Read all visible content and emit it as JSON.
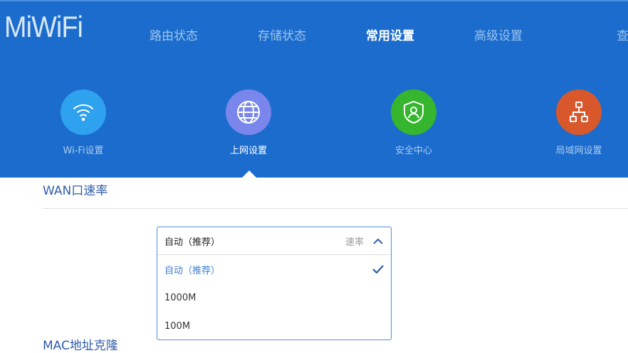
{
  "header": {
    "logo": "MiWiFi",
    "nav": [
      {
        "label": "路由状态",
        "active": false
      },
      {
        "label": "存储状态",
        "active": false
      },
      {
        "label": "常用设置",
        "active": true
      },
      {
        "label": "高级设置",
        "active": false
      },
      {
        "label": "查",
        "active": false
      }
    ]
  },
  "tiles": [
    {
      "label": "Wi-Fi设置",
      "icon": "wifi-icon",
      "color": "#2ea1ef"
    },
    {
      "label": "上网设置",
      "icon": "globe-icon",
      "color": "#7b86ec"
    },
    {
      "label": "安全中心",
      "icon": "shield-user-icon",
      "color": "#36b52e"
    },
    {
      "label": "局域网设置",
      "icon": "network-icon",
      "color": "#d9582b"
    }
  ],
  "section": {
    "title": "WAN口速率",
    "next_title": "MAC地址克隆"
  },
  "dropdown": {
    "value": "自动（推荐）",
    "unit": "速率",
    "options": [
      "自动（推荐）",
      "1000M",
      "100M"
    ],
    "selected_index": 0
  }
}
